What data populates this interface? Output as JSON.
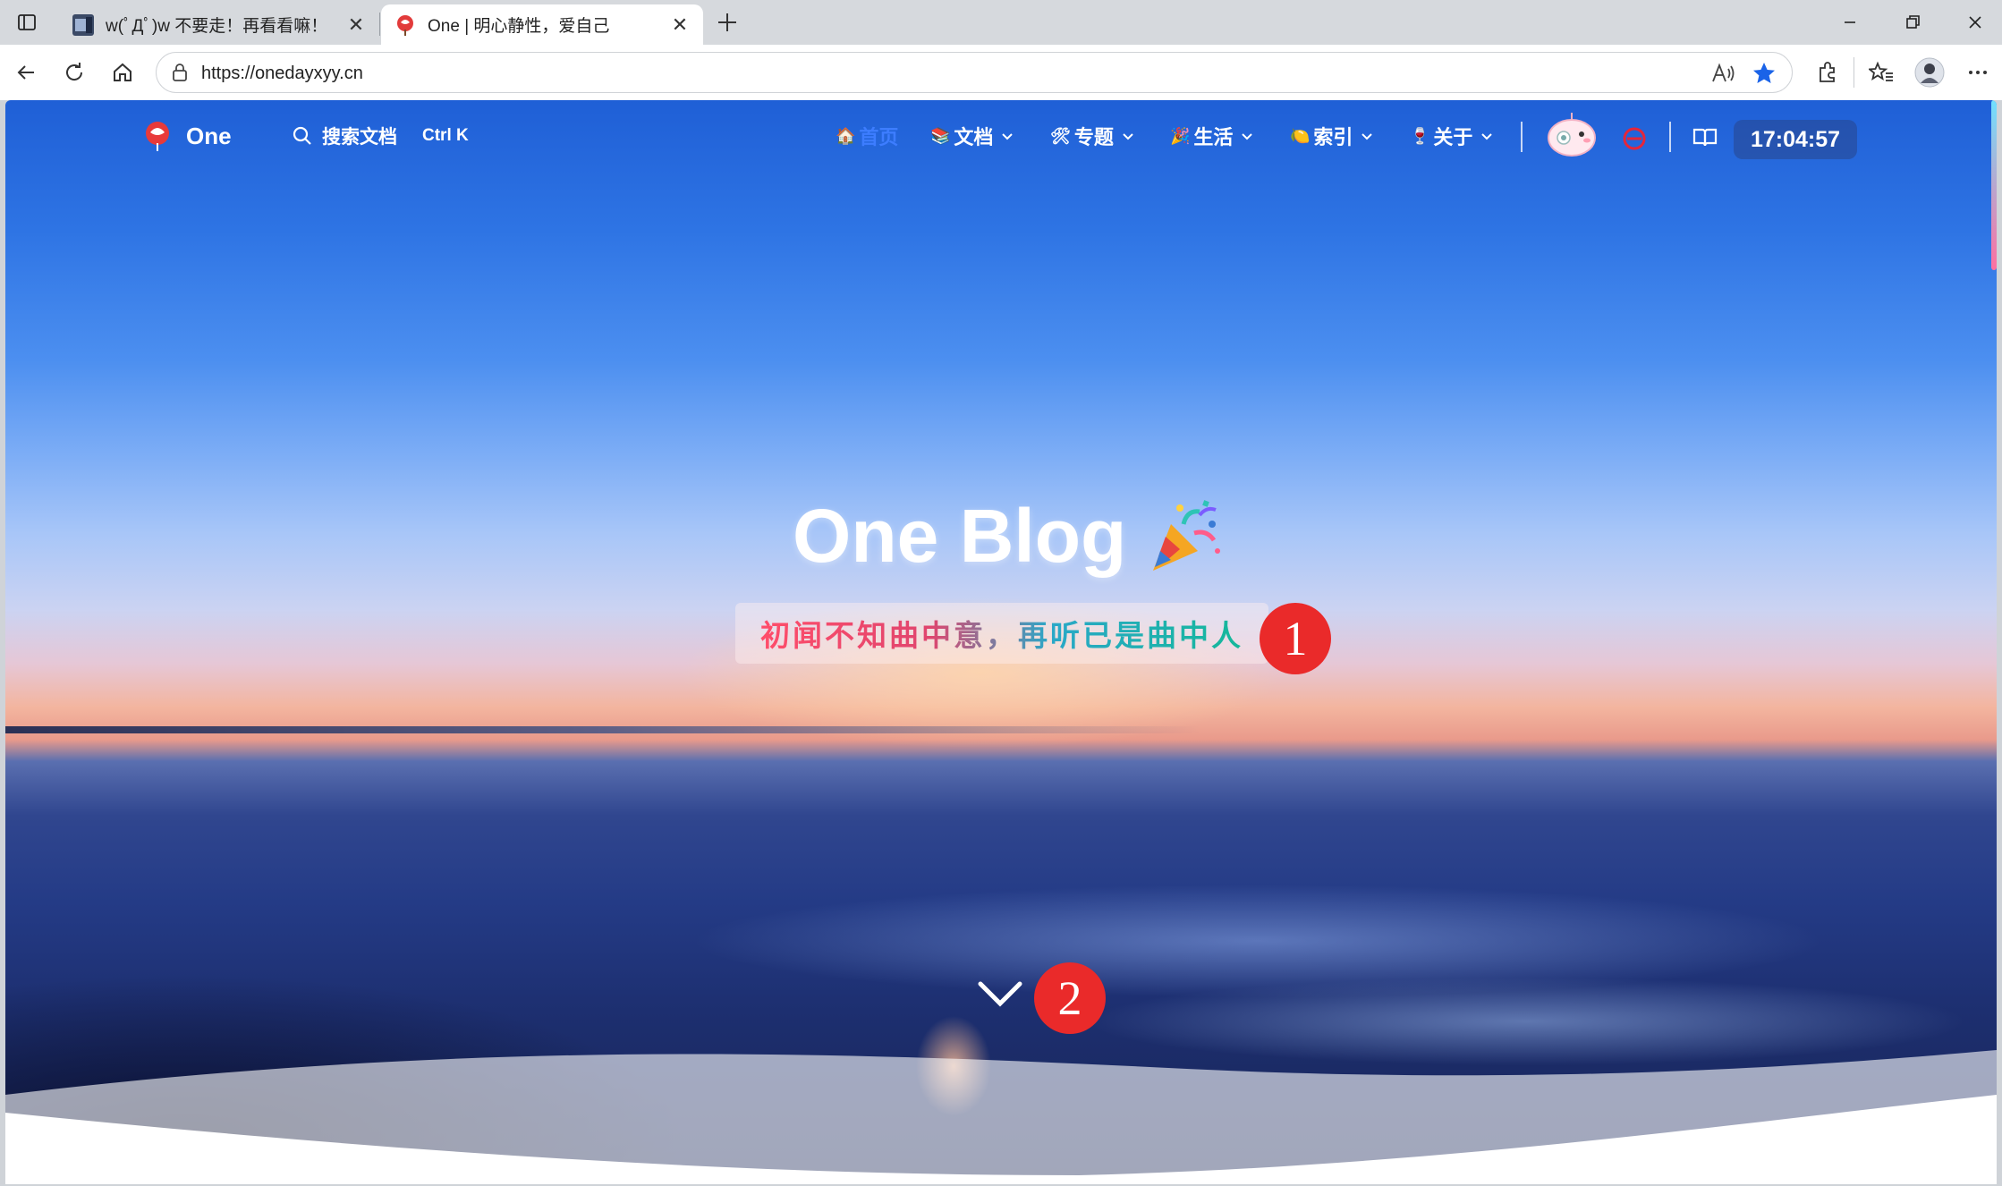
{
  "browser": {
    "tabs": [
      {
        "title": "w(ﾟДﾟ)w 不要走！再看看嘛！",
        "active": false
      },
      {
        "title": "One | 明心静性，爱自己",
        "active": true
      }
    ],
    "address": {
      "url": "https://onedayxyy.cn"
    }
  },
  "site": {
    "logo_text": "One",
    "search_label": "搜索文档",
    "search_shortcut": "Ctrl K",
    "nav": [
      {
        "emoji": "🏠",
        "label": "首页",
        "has_dropdown": false,
        "active": true
      },
      {
        "emoji": "📚",
        "label": "文档",
        "has_dropdown": true
      },
      {
        "emoji": "🛠",
        "label": "专题",
        "has_dropdown": true
      },
      {
        "emoji": "🎉",
        "label": "生活",
        "has_dropdown": true
      },
      {
        "emoji": "🍋",
        "label": "索引",
        "has_dropdown": true
      },
      {
        "emoji": "🍷",
        "label": "关于",
        "has_dropdown": true
      }
    ],
    "clock": "17:04:57"
  },
  "hero": {
    "title": "One Blog",
    "subtitle": "初闻不知曲中意，再听已是曲中人"
  },
  "annotations": [
    "1",
    "2"
  ],
  "colors": {
    "accent_blue": "#3d7dff",
    "badge_red": "#ea2a2a",
    "subtitle_gradient_start": "#ff4d6a",
    "subtitle_gradient_end": "#15b89a",
    "favorite_star": "#1a63e8"
  }
}
